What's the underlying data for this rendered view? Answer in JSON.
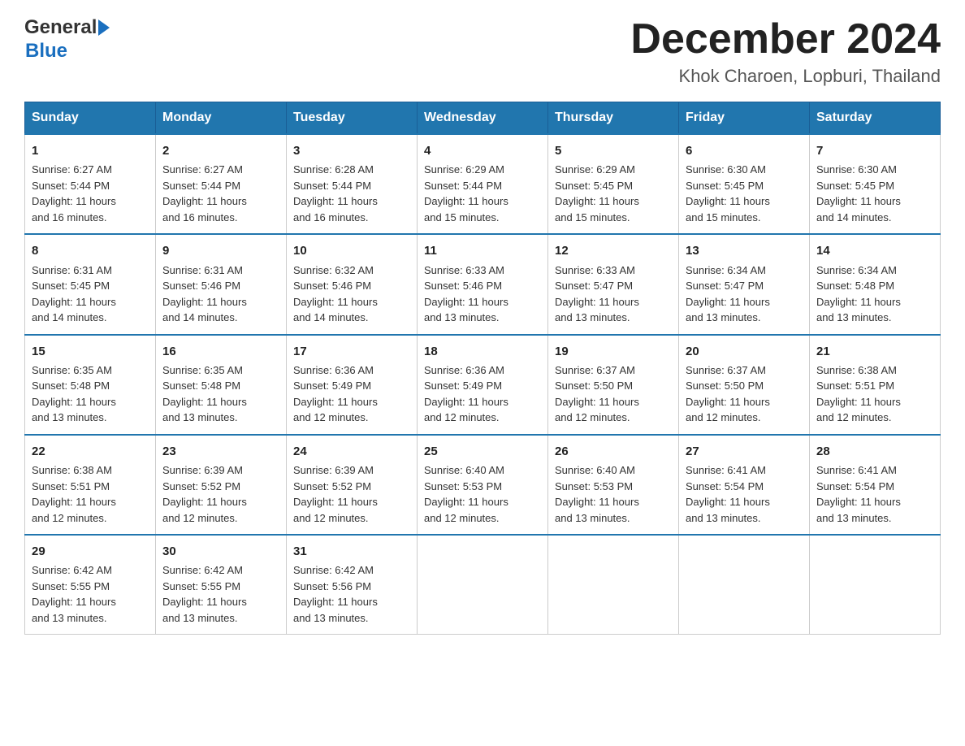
{
  "header": {
    "title": "December 2024",
    "location": "Khok Charoen, Lopburi, Thailand",
    "logo_general": "General",
    "logo_blue": "Blue"
  },
  "days_of_week": [
    "Sunday",
    "Monday",
    "Tuesday",
    "Wednesday",
    "Thursday",
    "Friday",
    "Saturday"
  ],
  "weeks": [
    [
      {
        "day": "1",
        "sunrise": "6:27 AM",
        "sunset": "5:44 PM",
        "daylight": "11 hours and 16 minutes."
      },
      {
        "day": "2",
        "sunrise": "6:27 AM",
        "sunset": "5:44 PM",
        "daylight": "11 hours and 16 minutes."
      },
      {
        "day": "3",
        "sunrise": "6:28 AM",
        "sunset": "5:44 PM",
        "daylight": "11 hours and 16 minutes."
      },
      {
        "day": "4",
        "sunrise": "6:29 AM",
        "sunset": "5:44 PM",
        "daylight": "11 hours and 15 minutes."
      },
      {
        "day": "5",
        "sunrise": "6:29 AM",
        "sunset": "5:45 PM",
        "daylight": "11 hours and 15 minutes."
      },
      {
        "day": "6",
        "sunrise": "6:30 AM",
        "sunset": "5:45 PM",
        "daylight": "11 hours and 15 minutes."
      },
      {
        "day": "7",
        "sunrise": "6:30 AM",
        "sunset": "5:45 PM",
        "daylight": "11 hours and 14 minutes."
      }
    ],
    [
      {
        "day": "8",
        "sunrise": "6:31 AM",
        "sunset": "5:45 PM",
        "daylight": "11 hours and 14 minutes."
      },
      {
        "day": "9",
        "sunrise": "6:31 AM",
        "sunset": "5:46 PM",
        "daylight": "11 hours and 14 minutes."
      },
      {
        "day": "10",
        "sunrise": "6:32 AM",
        "sunset": "5:46 PM",
        "daylight": "11 hours and 14 minutes."
      },
      {
        "day": "11",
        "sunrise": "6:33 AM",
        "sunset": "5:46 PM",
        "daylight": "11 hours and 13 minutes."
      },
      {
        "day": "12",
        "sunrise": "6:33 AM",
        "sunset": "5:47 PM",
        "daylight": "11 hours and 13 minutes."
      },
      {
        "day": "13",
        "sunrise": "6:34 AM",
        "sunset": "5:47 PM",
        "daylight": "11 hours and 13 minutes."
      },
      {
        "day": "14",
        "sunrise": "6:34 AM",
        "sunset": "5:48 PM",
        "daylight": "11 hours and 13 minutes."
      }
    ],
    [
      {
        "day": "15",
        "sunrise": "6:35 AM",
        "sunset": "5:48 PM",
        "daylight": "11 hours and 13 minutes."
      },
      {
        "day": "16",
        "sunrise": "6:35 AM",
        "sunset": "5:48 PM",
        "daylight": "11 hours and 13 minutes."
      },
      {
        "day": "17",
        "sunrise": "6:36 AM",
        "sunset": "5:49 PM",
        "daylight": "11 hours and 12 minutes."
      },
      {
        "day": "18",
        "sunrise": "6:36 AM",
        "sunset": "5:49 PM",
        "daylight": "11 hours and 12 minutes."
      },
      {
        "day": "19",
        "sunrise": "6:37 AM",
        "sunset": "5:50 PM",
        "daylight": "11 hours and 12 minutes."
      },
      {
        "day": "20",
        "sunrise": "6:37 AM",
        "sunset": "5:50 PM",
        "daylight": "11 hours and 12 minutes."
      },
      {
        "day": "21",
        "sunrise": "6:38 AM",
        "sunset": "5:51 PM",
        "daylight": "11 hours and 12 minutes."
      }
    ],
    [
      {
        "day": "22",
        "sunrise": "6:38 AM",
        "sunset": "5:51 PM",
        "daylight": "11 hours and 12 minutes."
      },
      {
        "day": "23",
        "sunrise": "6:39 AM",
        "sunset": "5:52 PM",
        "daylight": "11 hours and 12 minutes."
      },
      {
        "day": "24",
        "sunrise": "6:39 AM",
        "sunset": "5:52 PM",
        "daylight": "11 hours and 12 minutes."
      },
      {
        "day": "25",
        "sunrise": "6:40 AM",
        "sunset": "5:53 PM",
        "daylight": "11 hours and 12 minutes."
      },
      {
        "day": "26",
        "sunrise": "6:40 AM",
        "sunset": "5:53 PM",
        "daylight": "11 hours and 13 minutes."
      },
      {
        "day": "27",
        "sunrise": "6:41 AM",
        "sunset": "5:54 PM",
        "daylight": "11 hours and 13 minutes."
      },
      {
        "day": "28",
        "sunrise": "6:41 AM",
        "sunset": "5:54 PM",
        "daylight": "11 hours and 13 minutes."
      }
    ],
    [
      {
        "day": "29",
        "sunrise": "6:42 AM",
        "sunset": "5:55 PM",
        "daylight": "11 hours and 13 minutes."
      },
      {
        "day": "30",
        "sunrise": "6:42 AM",
        "sunset": "5:55 PM",
        "daylight": "11 hours and 13 minutes."
      },
      {
        "day": "31",
        "sunrise": "6:42 AM",
        "sunset": "5:56 PM",
        "daylight": "11 hours and 13 minutes."
      },
      null,
      null,
      null,
      null
    ]
  ],
  "labels": {
    "sunrise": "Sunrise:",
    "sunset": "Sunset:",
    "daylight": "Daylight:"
  }
}
